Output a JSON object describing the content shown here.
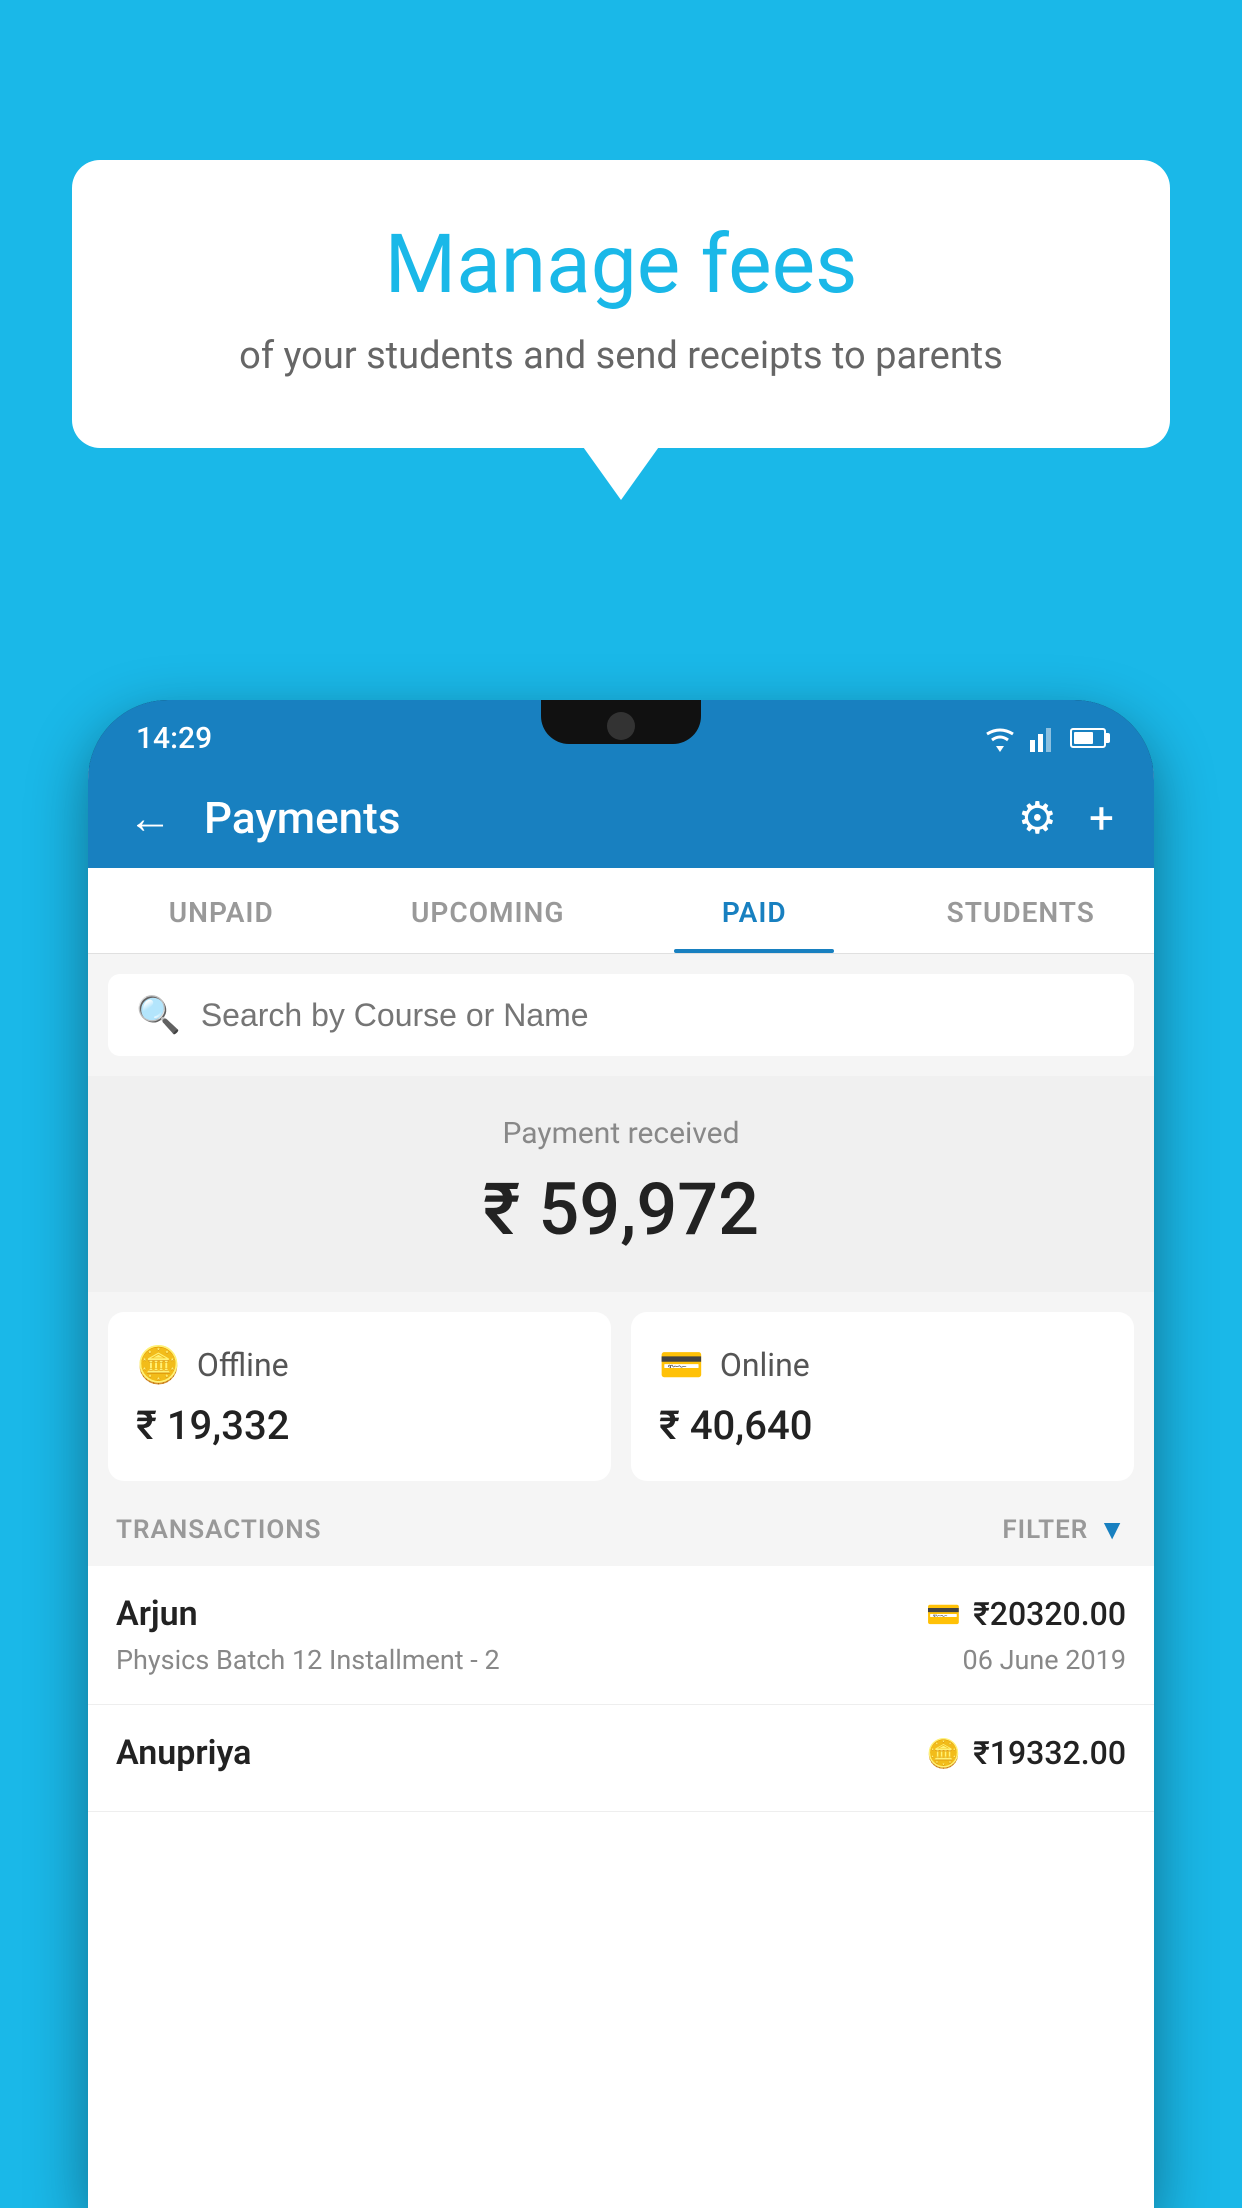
{
  "page": {
    "background_color": "#1ab8e8"
  },
  "speech_bubble": {
    "title": "Manage fees",
    "subtitle": "of your students and send receipts to parents"
  },
  "status_bar": {
    "time": "14:29"
  },
  "header": {
    "title": "Payments",
    "back_label": "←",
    "settings_label": "⚙",
    "add_label": "+"
  },
  "tabs": [
    {
      "id": "unpaid",
      "label": "UNPAID",
      "active": false
    },
    {
      "id": "upcoming",
      "label": "UPCOMING",
      "active": false
    },
    {
      "id": "paid",
      "label": "PAID",
      "active": true
    },
    {
      "id": "students",
      "label": "STUDENTS",
      "active": false
    }
  ],
  "search": {
    "placeholder": "Search by Course or Name"
  },
  "payment_received": {
    "label": "Payment received",
    "amount": "₹ 59,972"
  },
  "payment_cards": [
    {
      "id": "offline",
      "icon": "🪙",
      "type_label": "Offline",
      "amount": "₹ 19,332"
    },
    {
      "id": "online",
      "icon": "💳",
      "type_label": "Online",
      "amount": "₹ 40,640"
    }
  ],
  "transactions_section": {
    "label": "TRANSACTIONS",
    "filter_label": "FILTER"
  },
  "transactions": [
    {
      "name": "Arjun",
      "amount": "₹20320.00",
      "course": "Physics Batch 12 Installment - 2",
      "date": "06 June 2019",
      "payment_type": "online"
    },
    {
      "name": "Anupriya",
      "amount": "₹19332.00",
      "course": "",
      "date": "",
      "payment_type": "offline"
    }
  ]
}
